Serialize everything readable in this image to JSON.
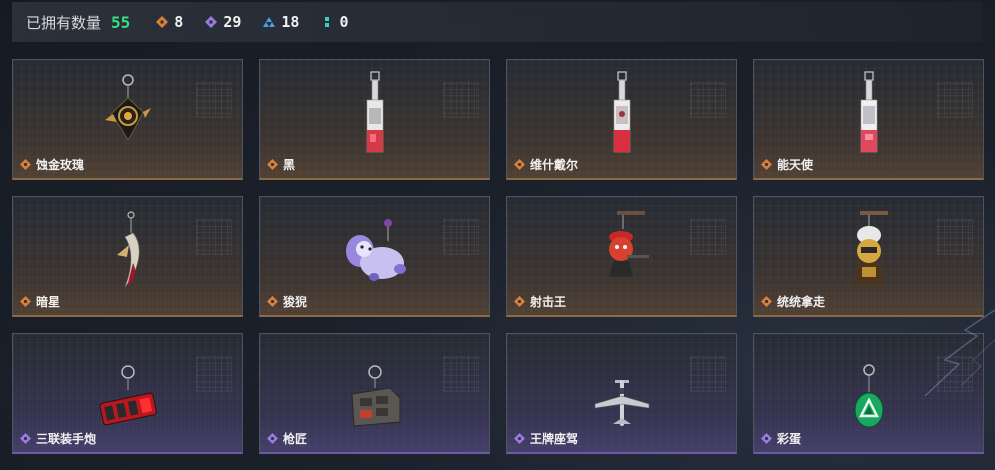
{
  "header": {
    "owned_label": "已拥有数量",
    "owned_count": "55",
    "stats": [
      {
        "icon": "orange-diamond-icon",
        "color": "#d9803a",
        "value": "8"
      },
      {
        "icon": "purple-diamond-icon",
        "color": "#9a7ae0",
        "value": "29"
      },
      {
        "icon": "blue-triangle-icon",
        "color": "#4e9de0",
        "value": "18"
      },
      {
        "icon": "teal-colon-icon",
        "color": "#3ad0c0",
        "value": "0"
      }
    ]
  },
  "colors": {
    "orange_rarity": "#d9803a",
    "purple_rarity": "#9a7ae0",
    "owned_green": "#36e07a"
  },
  "items": [
    {
      "name": "蚀金玫瑰",
      "rarity": "orange",
      "icon": "gold-rose-charm-icon"
    },
    {
      "name": "黑",
      "rarity": "orange",
      "icon": "card-pendant-charm-icon"
    },
    {
      "name": "维什戴尔",
      "rarity": "orange",
      "icon": "card-pendant-charm-icon"
    },
    {
      "name": "能天使",
      "rarity": "orange",
      "icon": "card-pendant-charm-icon"
    },
    {
      "name": "暗星",
      "rarity": "orange",
      "icon": "crescent-blade-charm-icon"
    },
    {
      "name": "狻猊",
      "rarity": "orange",
      "icon": "lion-plush-charm-icon"
    },
    {
      "name": "射击王",
      "rarity": "orange",
      "icon": "gunner-doll-charm-icon"
    },
    {
      "name": "统统拿走",
      "rarity": "orange",
      "icon": "masked-figure-charm-icon"
    },
    {
      "name": "三联装手炮",
      "rarity": "purple",
      "icon": "triple-cannon-charm-icon"
    },
    {
      "name": "枪匠",
      "rarity": "purple",
      "icon": "toolbox-charm-icon"
    },
    {
      "name": "王牌座驾",
      "rarity": "purple",
      "icon": "jet-plane-charm-icon"
    },
    {
      "name": "彩蛋",
      "rarity": "purple",
      "icon": "green-egg-charm-icon"
    }
  ]
}
